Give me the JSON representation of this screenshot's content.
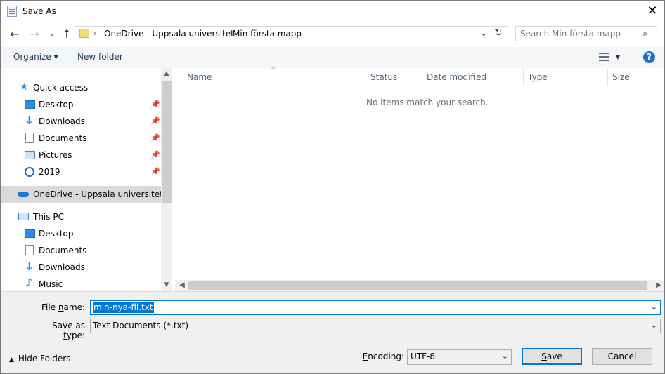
{
  "window": {
    "title": "Save As",
    "close_glyph": "✕"
  },
  "nav": {
    "back_glyph": "←",
    "forward_glyph": "→",
    "recent_glyph": "⌄",
    "up_glyph": "↑",
    "breadcrumb": [
      "OneDrive - Uppsala universitet",
      "Min första mapp"
    ],
    "breadcrumb_sep": "›",
    "search_placeholder": "Search Min första mapp"
  },
  "toolbar": {
    "organize_label": "Organize ▾",
    "new_folder_label": "New folder",
    "view_dropdown": "▾",
    "help_label": "?"
  },
  "sidebar": {
    "quick_access": "Quick access",
    "quick_items": [
      {
        "label": "Desktop",
        "icon": "desktop-icon"
      },
      {
        "label": "Downloads",
        "icon": "download-icon"
      },
      {
        "label": "Documents",
        "icon": "documents-icon"
      },
      {
        "label": "Pictures",
        "icon": "pictures-icon"
      },
      {
        "label": "2019",
        "icon": "folder-sync-icon"
      }
    ],
    "onedrive": "OneDrive - Uppsala universitet",
    "this_pc": "This PC",
    "pc_items": [
      {
        "label": "Desktop",
        "icon": "desktop-icon"
      },
      {
        "label": "Documents",
        "icon": "documents-icon"
      },
      {
        "label": "Downloads",
        "icon": "download-icon"
      },
      {
        "label": "Music",
        "icon": "music-icon"
      }
    ]
  },
  "columns": [
    "Name",
    "Status",
    "Date modified",
    "Type",
    "Size"
  ],
  "empty_message": "No items match your search.",
  "form": {
    "file_name_label_pre": "File ",
    "file_name_label_u": "n",
    "file_name_label_post": "ame:",
    "file_name_value": "min-nya-fil.txt",
    "save_type_label_pre": "Save as ",
    "save_type_label_u": "t",
    "save_type_label_post": "ype:",
    "save_type_value": "Text Documents (*.txt)",
    "encoding_label_u": "E",
    "encoding_label_post": "ncoding:",
    "encoding_value": "UTF-8",
    "hide_folders": "Hide Folders",
    "save_u": "S",
    "save_post": "ave",
    "cancel": "Cancel"
  }
}
